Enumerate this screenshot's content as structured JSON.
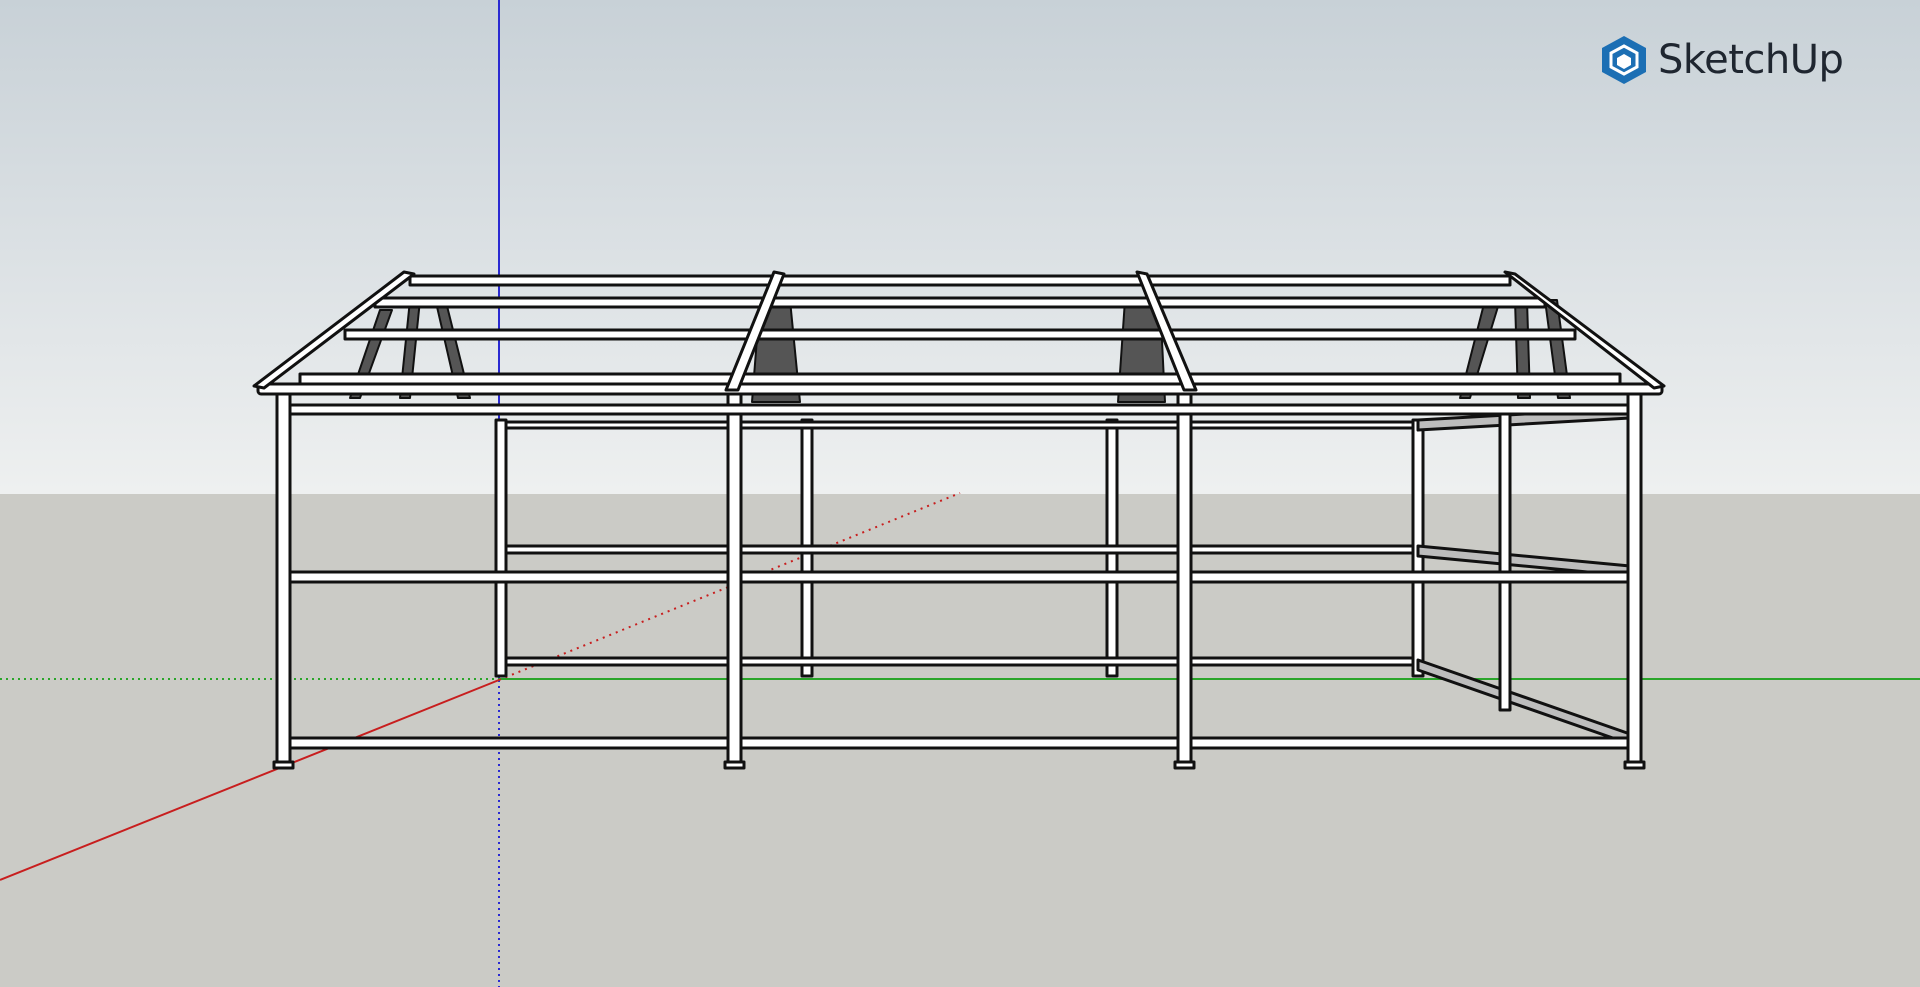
{
  "app": {
    "brand_name": "SketchUp",
    "logo_icon": "sketchup-logo-icon"
  },
  "colors": {
    "x_axis": "#c81e1e",
    "y_axis": "#2aa52a",
    "z_axis": "#2a2ad2",
    "sky_top": "#c8d1d7",
    "sky_bottom": "#eef0f0",
    "ground": "#cbcbc6",
    "logo": "#1c6fb4"
  }
}
